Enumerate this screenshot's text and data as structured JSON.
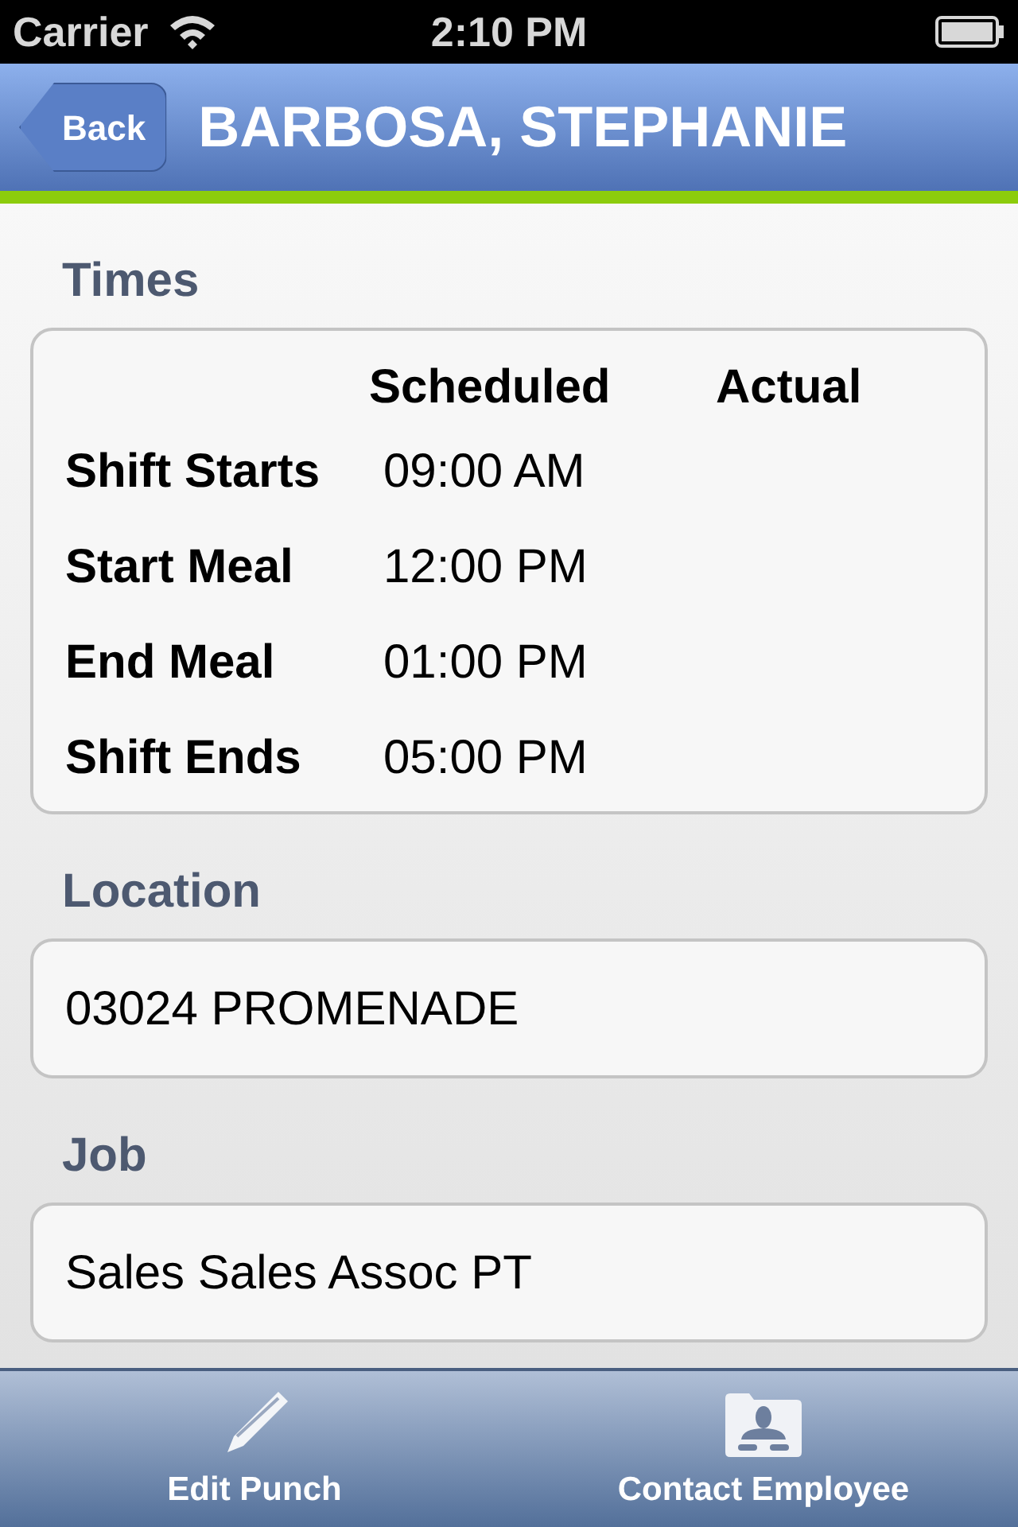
{
  "status_bar": {
    "carrier": "Carrier",
    "time": "2:10 PM"
  },
  "nav": {
    "back": "Back",
    "title": "BARBOSA, STEPHANIE"
  },
  "sections": [
    {
      "kind": "times",
      "heading": "Times",
      "columns": [
        "Scheduled",
        "Actual"
      ],
      "rows": [
        {
          "label": "Shift Starts",
          "scheduled": "09:00 AM"
        },
        {
          "label": "Start Meal",
          "scheduled": "12:00 PM"
        },
        {
          "label": "End Meal",
          "scheduled": "01:00 PM"
        },
        {
          "label": "Shift Ends",
          "scheduled": "05:00 PM"
        }
      ]
    },
    {
      "kind": "text",
      "heading": "Location",
      "value": "03024 PROMENADE"
    },
    {
      "kind": "text",
      "heading": "Job",
      "value": "Sales Sales Assoc PT"
    }
  ],
  "tab_bar": [
    {
      "kind": "pencil",
      "label": "Edit Punch"
    },
    {
      "kind": "contact",
      "label": "Contact Employee"
    }
  ]
}
